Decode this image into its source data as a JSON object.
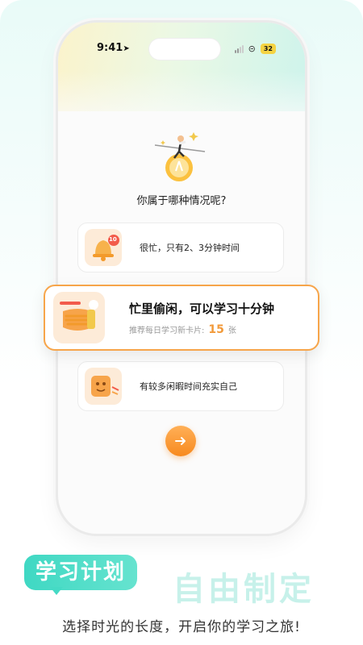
{
  "status_bar": {
    "time": "9:41",
    "battery": "32"
  },
  "question": "你属于哪种情况呢?",
  "options": [
    {
      "label": "很忙，只有2、3分钟时间",
      "badge": "10"
    },
    {
      "title": "忙里偷闲，可以学习十分钟",
      "sub_prefix": "推荐每日学习新卡片:",
      "count": "15",
      "unit": "张"
    },
    {
      "label": "有较多闲暇时间充实自己"
    }
  ],
  "promo": {
    "tag": "学习计划",
    "title": "自由制定",
    "subtitle": "选择时光的长度，开启你的学习之旅!"
  },
  "colors": {
    "accent": "#f78a1f",
    "teal": "#3fd8c3"
  }
}
